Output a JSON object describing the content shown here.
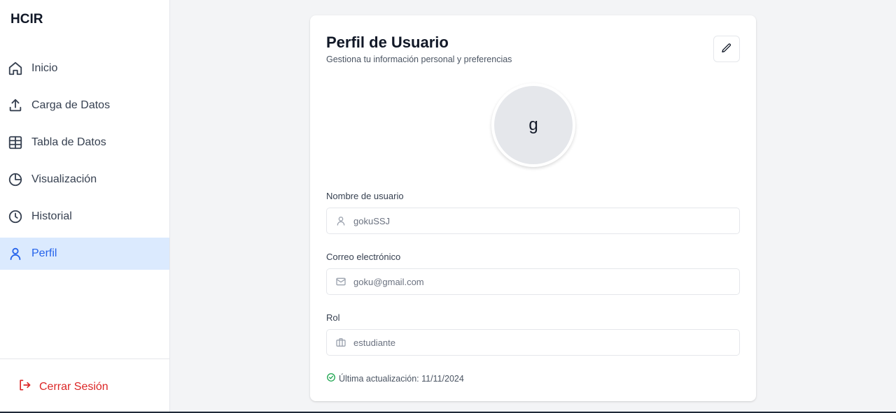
{
  "app": {
    "brand": "HCIR"
  },
  "sidebar": {
    "items": [
      {
        "label": "Inicio",
        "icon": "home-icon"
      },
      {
        "label": "Carga de Datos",
        "icon": "upload-icon"
      },
      {
        "label": "Tabla de Datos",
        "icon": "table-icon"
      },
      {
        "label": "Visualización",
        "icon": "pie-chart-icon"
      },
      {
        "label": "Historial",
        "icon": "clock-icon"
      },
      {
        "label": "Perfil",
        "icon": "user-icon",
        "active": true
      }
    ],
    "logout_label": "Cerrar Sesión"
  },
  "profile": {
    "title": "Perfil de Usuario",
    "subtitle": "Gestiona tu información personal y preferencias",
    "avatar_initial": "g",
    "fields": [
      {
        "label": "Nombre de usuario",
        "value": "gokuSSJ",
        "icon": "user-icon"
      },
      {
        "label": "Correo electrónico",
        "value": "goku@gmail.com",
        "icon": "mail-icon"
      },
      {
        "label": "Rol",
        "value": "estudiante",
        "icon": "briefcase-icon"
      }
    ],
    "last_updated": "Última actualización: 11/11/2024"
  },
  "colors": {
    "accent": "#2563eb",
    "active_bg": "#dbeafe",
    "danger": "#dc2626",
    "success": "#16a34a",
    "page_bg": "#f3f4f6"
  }
}
